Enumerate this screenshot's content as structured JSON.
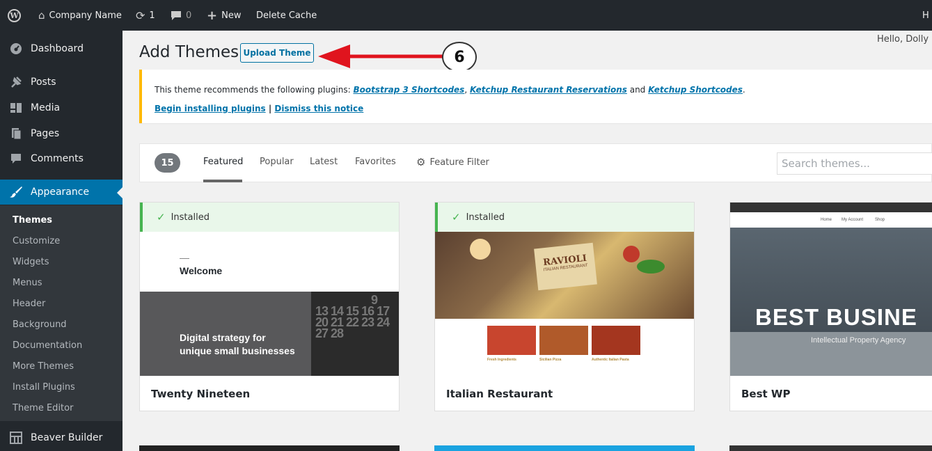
{
  "adminbar": {
    "site_name": "Company Name",
    "updates_count": "1",
    "comments_count": "0",
    "new_label": "New",
    "delete_cache": "Delete Cache",
    "right_initial": "H"
  },
  "sidebar": {
    "items": [
      {
        "label": "Dashboard",
        "icon": "dashboard-icon"
      },
      {
        "label": "Posts",
        "icon": "pin-icon"
      },
      {
        "label": "Media",
        "icon": "media-icon"
      },
      {
        "label": "Pages",
        "icon": "pages-icon"
      },
      {
        "label": "Comments",
        "icon": "comment-icon"
      },
      {
        "label": "Appearance",
        "icon": "brush-icon"
      }
    ],
    "submenu": [
      "Themes",
      "Customize",
      "Widgets",
      "Menus",
      "Header",
      "Background",
      "Documentation",
      "More Themes",
      "Install Plugins",
      "Theme Editor"
    ],
    "beaver": {
      "label": "Beaver Builder",
      "icon": "grid-icon"
    },
    "accent": "#0073aa"
  },
  "main": {
    "title": "Add Themes",
    "upload_label": "Upload Theme",
    "hello": "Hello, Dolly",
    "annotation_number": "6"
  },
  "notice": {
    "prefix": "This theme recommends the following plugins: ",
    "plugin1": "Bootstrap 3 Shortcodes",
    "comma": ", ",
    "plugin2": "Ketchup Restaurant Reservations",
    "and_text": " and ",
    "plugin3": "Ketchup Shortcodes",
    "period": ".",
    "begin": "Begin installing plugins",
    "sep": " | ",
    "dismiss": "Dismiss this notice"
  },
  "filter": {
    "count": "15",
    "tabs": [
      "Featured",
      "Popular",
      "Latest",
      "Favorites"
    ],
    "feature_filter": "Feature Filter",
    "search_placeholder": "Search themes..."
  },
  "themes": [
    {
      "name": "Twenty Nineteen",
      "installed": "Installed",
      "preview": {
        "welcome": "Welcome",
        "tagline1": "Digital strategy for",
        "tagline2": "unique small businesses",
        "cal_row1": "9",
        "cal_row2": "13 14 15 16 17",
        "cal_row3": "20 21 22 23 24",
        "cal_row4": "27 28"
      }
    },
    {
      "name": "Italian Restaurant",
      "installed": "Installed",
      "preview": {
        "logo": "RAVIOLI",
        "logo_sub": "ITALIAN RESTAURANT",
        "cols": [
          "Fresh Ingredients",
          "Sicilian Pizza",
          "Authentic Italian Pasta"
        ]
      }
    },
    {
      "name": "Best WP",
      "preview": {
        "nav": [
          "Home",
          "My Account",
          "Shop"
        ],
        "headline": "BEST BUSINE",
        "sub": "Intellectual Property Agency"
      }
    }
  ]
}
